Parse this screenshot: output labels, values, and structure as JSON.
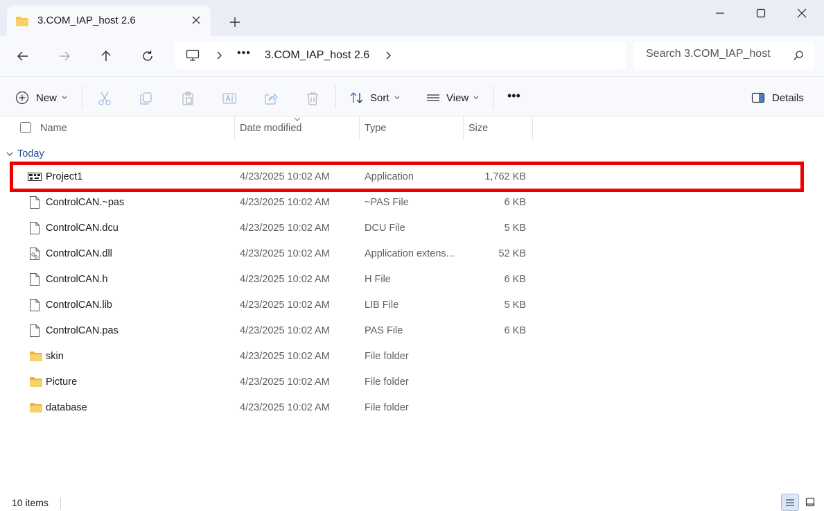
{
  "window": {
    "tab_title": "3.COM_IAP_host 2.6"
  },
  "address": {
    "overflow_label": "•••",
    "crumb": "3.COM_IAP_host 2.6"
  },
  "search": {
    "placeholder": "Search 3.COM_IAP_host"
  },
  "commands": {
    "new_label": "New",
    "sort_label": "Sort",
    "view_label": "View",
    "more_label": "•••",
    "details_label": "Details"
  },
  "columns": {
    "name": "Name",
    "date": "Date modified",
    "type": "Type",
    "size": "Size"
  },
  "group": {
    "label": "Today"
  },
  "files": [
    {
      "name": "Project1",
      "date": "4/23/2025 10:02 AM",
      "type": "Application",
      "size": "1,762 KB",
      "icon": "application-icon"
    },
    {
      "name": "ControlCAN.~pas",
      "date": "4/23/2025 10:02 AM",
      "type": "~PAS File",
      "size": "6 KB",
      "icon": "file-icon"
    },
    {
      "name": "ControlCAN.dcu",
      "date": "4/23/2025 10:02 AM",
      "type": "DCU File",
      "size": "5 KB",
      "icon": "file-icon"
    },
    {
      "name": "ControlCAN.dll",
      "date": "4/23/2025 10:02 AM",
      "type": "Application extens...",
      "size": "52 KB",
      "icon": "dll-file-icon"
    },
    {
      "name": "ControlCAN.h",
      "date": "4/23/2025 10:02 AM",
      "type": "H File",
      "size": "6 KB",
      "icon": "file-icon"
    },
    {
      "name": "ControlCAN.lib",
      "date": "4/23/2025 10:02 AM",
      "type": "LIB File",
      "size": "5 KB",
      "icon": "file-icon"
    },
    {
      "name": "ControlCAN.pas",
      "date": "4/23/2025 10:02 AM",
      "type": "PAS File",
      "size": "6 KB",
      "icon": "file-icon"
    },
    {
      "name": "skin",
      "date": "4/23/2025 10:02 AM",
      "type": "File folder",
      "size": "",
      "icon": "folder-icon"
    },
    {
      "name": "Picture",
      "date": "4/23/2025 10:02 AM",
      "type": "File folder",
      "size": "",
      "icon": "folder-icon"
    },
    {
      "name": "database",
      "date": "4/23/2025 10:02 AM",
      "type": "File folder",
      "size": "",
      "icon": "folder-icon"
    }
  ],
  "status": {
    "item_count": "10 items"
  },
  "colors": {
    "highlight": "#ee0000",
    "folder": "#f4c542",
    "group_label": "#1f4e8c"
  }
}
